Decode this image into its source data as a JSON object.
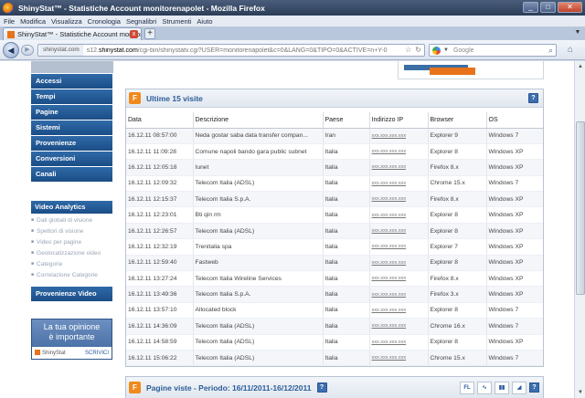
{
  "window": {
    "title": "ShinyStat™ - Statistiche Account monitorenapolet - Mozilla Firefox",
    "minimize_symbol": "_",
    "maximize_symbol": "□",
    "close_symbol": "✕"
  },
  "menu": [
    "File",
    "Modifica",
    "Visualizza",
    "Cronologia",
    "Segnalibri",
    "Strumenti",
    "Aiuto"
  ],
  "tab": {
    "label": "ShinyStat™ - Statistiche Account monitore...",
    "close": "x",
    "new_tab": "+"
  },
  "nav": {
    "back": "◀",
    "forward": "▶",
    "site_label": "shinystat.com",
    "url_prefix": "s12.",
    "url_domain": "shinystat.com",
    "url_path": "/cgi-bin/shinystatv.cgi?USER=monitorenapolet&c=0&LANG=0&TIPO=0&ACTIVE=n+Y-0",
    "star": "☆",
    "reload": "↻",
    "search_placeholder": "Google",
    "home": "⌂"
  },
  "sidebar": {
    "items": [
      "Accessi",
      "Tempi",
      "Pagine",
      "Sistemi",
      "Provenienze",
      "Conversioni",
      "Canali"
    ],
    "video_title": "Video Analytics",
    "video_items": [
      "Dati globali di visione",
      "Spettori di visione",
      "Video per pagine",
      "Geolocalizzazione video",
      "Categorie",
      "Correlazione Categorie"
    ],
    "video_provenance": "Provenienze Video",
    "promo_line1": "La tua opinione",
    "promo_line2": "è importante",
    "promo_logo": "ShinyStat",
    "promo_action": "SCRIVICI"
  },
  "panel": {
    "icon": "F",
    "title": "Ultime 15 visite",
    "help": "?",
    "columns": [
      "Data",
      "Descrizione",
      "Paese",
      "Indirizzo IP",
      "Browser",
      "OS"
    ],
    "rows": [
      [
        "16.12.11  08:57:00",
        "Neda gostar saba data transfer compan...",
        "Iran",
        "xxx.xxx.xxx.xxx",
        "Explorer 9",
        "Windows 7"
      ],
      [
        "16.12.11  11:09:28",
        "Comune napoli bando gara public subnet",
        "Italia",
        "xxx.xxx.xxx.xxx",
        "Explorer 8",
        "Windows XP"
      ],
      [
        "16.12.11  12:05:18",
        "Iunet",
        "Italia",
        "xxx.xxx.xxx.xxx",
        "Firefox 8.x",
        "Windows XP"
      ],
      [
        "16.12.11  12:09:32",
        "Telecom Italia (ADSL)",
        "Italia",
        "xxx.xxx.xxx.xxx",
        "Chrome 15.x",
        "Windows 7"
      ],
      [
        "16.12.11  12:15:37",
        "Telecom Italia S.p.A.",
        "Italia",
        "xxx.xxx.xxx.xxx",
        "Firefox 8.x",
        "Windows XP"
      ],
      [
        "16.12.11  12:23:01",
        "Bti qin rm",
        "Italia",
        "xxx.xxx.xxx.xxx",
        "Explorer 8",
        "Windows XP"
      ],
      [
        "16.12.11  12:26:57",
        "Telecom Italia (ADSL)",
        "Italia",
        "xxx.xxx.xxx.xxx",
        "Explorer 8",
        "Windows XP"
      ],
      [
        "16.12.11  12:32:19",
        "Trenitalia spa",
        "Italia",
        "xxx.xxx.xxx.xxx",
        "Explorer 7",
        "Windows XP"
      ],
      [
        "16.12.11  12:59:40",
        "Fastweb",
        "Italia",
        "xxx.xxx.xxx.xxx",
        "Explorer 8",
        "Windows XP"
      ],
      [
        "16.12.11  13:27:24",
        "Telecom Italia Wireline Services",
        "Italia",
        "xxx.xxx.xxx.xxx",
        "Firefox 8.x",
        "Windows XP"
      ],
      [
        "16.12.11  13:49:36",
        "Telecom Italia S.p.A.",
        "Italia",
        "xxx.xxx.xxx.xxx",
        "Firefox 3.x",
        "Windows XP"
      ],
      [
        "16.12.11  13:57:10",
        "Allocated block",
        "Italia",
        "xxx.xxx.xxx.xxx",
        "Explorer 8",
        "Windows 7"
      ],
      [
        "16.12.11  14:36:09",
        "Telecom Italia (ADSL)",
        "Italia",
        "xxx.xxx.xxx.xxx",
        "Chrome 16.x",
        "Windows 7"
      ],
      [
        "16.12.11  14:58:59",
        "Telecom Italia (ADSL)",
        "Italia",
        "xxx.xxx.xxx.xxx",
        "Explorer 8",
        "Windows XP"
      ],
      [
        "16.12.11  15:06:22",
        "Telecom Italia (ADSL)",
        "Italia",
        "xxx.xxx.xxx.xxx",
        "Chrome 15.x",
        "Windows 7"
      ]
    ]
  },
  "panel2": {
    "icon": "F",
    "title": "Pagine viste - Periodo: 16/11/2011-16/12/2011",
    "help": "?",
    "tools": [
      "FL",
      "∿",
      "▮▮",
      "◢",
      "?"
    ]
  },
  "colors": {
    "nav_blue": "#1b4d86",
    "accent_orange": "#f08a1c",
    "title_blue": "#2b5d99"
  }
}
